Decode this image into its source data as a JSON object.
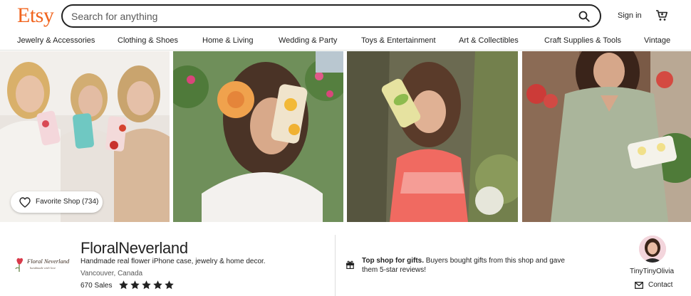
{
  "header": {
    "logo": "Etsy",
    "search_placeholder": "Search for anything",
    "sign_in": "Sign in",
    "brand_color": "#F1641E"
  },
  "nav": {
    "items": [
      "Jewelry & Accessories",
      "Clothing & Shoes",
      "Home & Living",
      "Wedding & Party",
      "Toys & Entertainment",
      "Art & Collectibles",
      "Craft Supplies & Tools",
      "Vintage"
    ]
  },
  "banner": {
    "favorite_label": "Favorite Shop (734)"
  },
  "shop": {
    "logo_text": "Floral Neverland",
    "logo_subtext": "handmade with love",
    "name": "FloralNeverland",
    "tagline": "Handmade real flower iPhone case, jewelry & home decor.",
    "location": "Vancouver, Canada",
    "sales": "670 Sales",
    "rating": 5
  },
  "top_shop": {
    "bold": "Top shop for gifts.",
    "text": " Buyers bought gifts from this shop and gave them 5-star reviews!"
  },
  "owner": {
    "name": "TinyTinyOlivia",
    "contact_label": "Contact"
  },
  "icons": [
    "search-icon",
    "cart-icon",
    "heart-icon",
    "star-icon",
    "gift-icon",
    "mail-icon"
  ]
}
